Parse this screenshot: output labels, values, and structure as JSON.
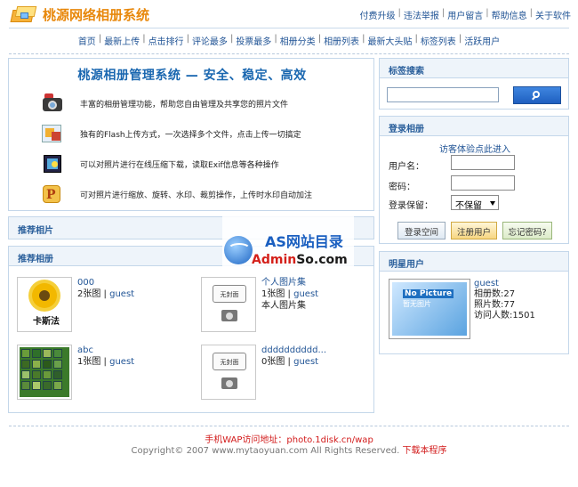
{
  "header": {
    "logo_text": "桃源网络相册系统",
    "top_links": [
      "付费升级",
      "违法举报",
      "用户留言",
      "帮助信息",
      "关于软件"
    ]
  },
  "nav": {
    "items": [
      "首页",
      "最新上传",
      "点击排行",
      "评论最多",
      "投票最多",
      "相册分类",
      "相册列表",
      "最新大头贴",
      "标签列表",
      "活跃用户"
    ]
  },
  "intro": {
    "title": "桃源相册管理系统 — 安全、稳定、高效",
    "features": [
      "丰富的相册管理功能，帮助您自由管理及共享您的照片文件",
      "独有的Flash上传方式，一次选择多个文件，点击上传一切搞定",
      "可以对照片进行在线压缩下载，读取Exif信息等各种操作",
      "可对照片进行缩放、旋转、水印、裁剪操作，上传时水印自动加注"
    ]
  },
  "rec_photo": {
    "title": "推荐相片"
  },
  "rec_albums": {
    "title": "推荐相册",
    "albums": [
      {
        "title": "000",
        "count": "2张图",
        "owner": "guest",
        "desc": "",
        "thumb_text": "卡斯法"
      },
      {
        "title": "个人图片集",
        "count": "1张图",
        "owner": "guest",
        "desc": "本人图片集",
        "thumb_text": "无封面"
      },
      {
        "title": "abc",
        "count": "1张图",
        "owner": "guest",
        "desc": "",
        "thumb_text": ""
      },
      {
        "title": "dddddddddd...",
        "count": "0张图",
        "owner": "guest",
        "desc": "",
        "thumb_text": "无封面"
      }
    ],
    "separator": " | "
  },
  "watermark": {
    "line1": "AS网站目录",
    "line2_a": "Admin",
    "line2_b": "So",
    "line2_c": ".com"
  },
  "tag_search": {
    "title": "标签搜索",
    "input_value": ""
  },
  "login": {
    "title": "登录相册",
    "guest_link": "访客体验点此进入",
    "username_label": "用户名：",
    "password_label": "密码：",
    "keep_label": "登录保留：",
    "keep_value": "不保留",
    "buttons": [
      "登录空间",
      "注册用户",
      "忘记密码?"
    ]
  },
  "star_users": {
    "title": "明星用户",
    "thumb_title": "No Picture",
    "thumb_sub": "暂无图片",
    "name": "guest",
    "albums": "相册数:27",
    "photos": "照片数:77",
    "visits": "访问人数:1501"
  },
  "footer": {
    "wap": "手机WAP访问地址：photo.1disk.cn/wap",
    "copyright": "Copyright© 2007 www.mytaoyuan.com All Rights Reserved.",
    "download": "下载本程序"
  }
}
